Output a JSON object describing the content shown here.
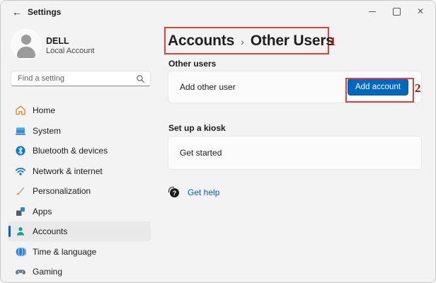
{
  "titlebar": {
    "back_glyph": "←",
    "title": "Settings",
    "close_glyph": "✕"
  },
  "profile": {
    "name": "DELL",
    "account_type": "Local Account"
  },
  "search": {
    "placeholder": "Find a setting"
  },
  "sidebar": {
    "items": [
      {
        "label": "Home",
        "icon": "home-icon",
        "selected": false
      },
      {
        "label": "System",
        "icon": "system-icon",
        "selected": false
      },
      {
        "label": "Bluetooth & devices",
        "icon": "bluetooth-icon",
        "selected": false
      },
      {
        "label": "Network & internet",
        "icon": "network-icon",
        "selected": false
      },
      {
        "label": "Personalization",
        "icon": "personalization-icon",
        "selected": false
      },
      {
        "label": "Apps",
        "icon": "apps-icon",
        "selected": false
      },
      {
        "label": "Accounts",
        "icon": "accounts-icon",
        "selected": true
      },
      {
        "label": "Time & language",
        "icon": "time-language-icon",
        "selected": false
      },
      {
        "label": "Gaming",
        "icon": "gaming-icon",
        "selected": false
      }
    ]
  },
  "main": {
    "breadcrumb": {
      "parent": "Accounts",
      "separator": "›",
      "current": "Other Users"
    },
    "section_other_users": {
      "heading": "Other users",
      "row_label": "Add other user",
      "button_label": "Add account"
    },
    "section_kiosk": {
      "heading": "Set up a kiosk",
      "row_label": "Get started"
    },
    "help_link": {
      "label": "Get help",
      "icon_glyph": "?"
    }
  },
  "annotations": {
    "step1": "1",
    "step2": "2"
  },
  "colors": {
    "accent": "#0067c0",
    "link": "#005fb8",
    "annotation_box": "#e0423b",
    "annotation_text": "#b3140e",
    "window_bg": "#f3f3f3",
    "card_bg": "#fbfbfb",
    "selected_item_bg": "#e9e9e9"
  }
}
